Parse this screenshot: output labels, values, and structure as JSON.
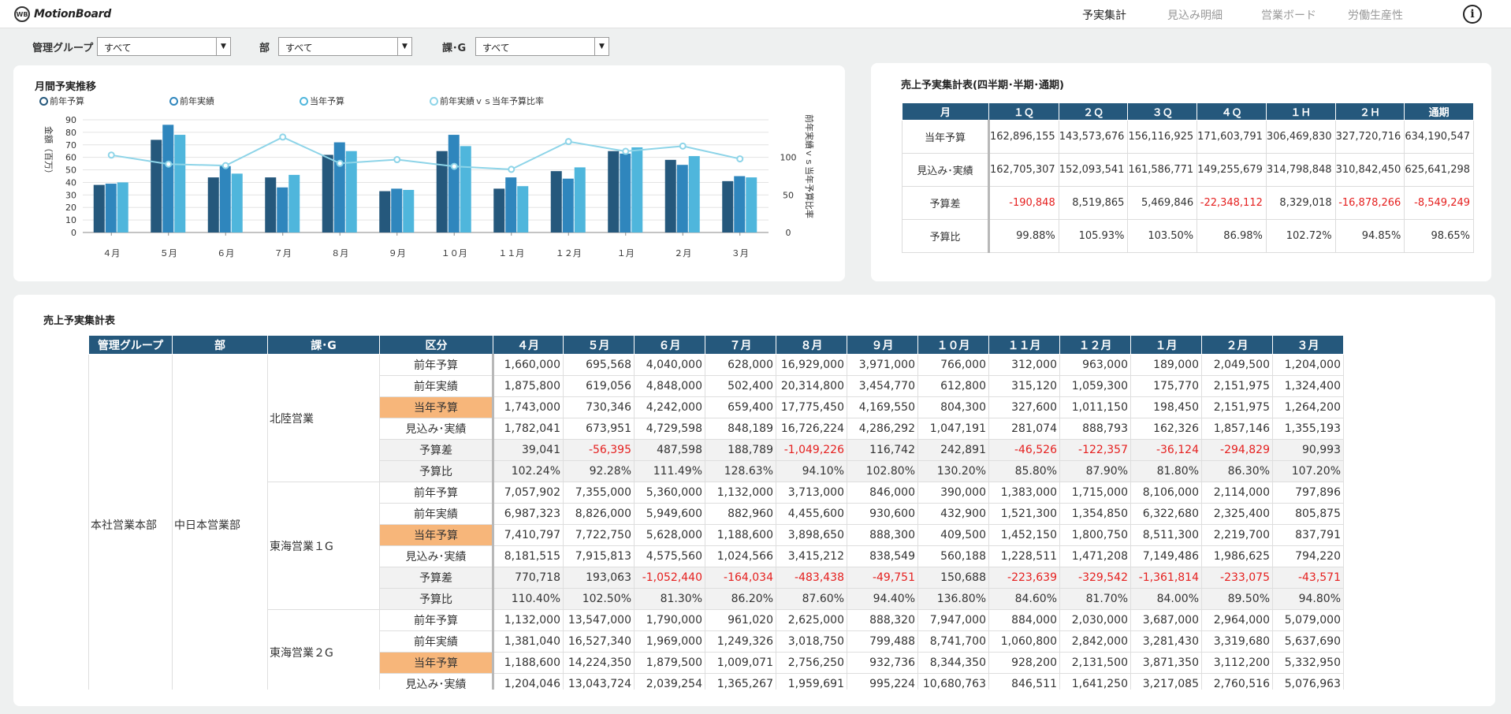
{
  "header": {
    "logo": "MotionBoard",
    "tabs": [
      {
        "label": "予実集計",
        "active": true
      },
      {
        "label": "見込み明細",
        "active": false
      },
      {
        "label": "営業ボード",
        "active": false
      },
      {
        "label": "労働生産性",
        "active": false
      }
    ],
    "info_icon": "info-icon"
  },
  "filters": [
    {
      "label": "管理グループ",
      "value": "すべて"
    },
    {
      "label": "部",
      "value": "すべて"
    },
    {
      "label": "課･G",
      "value": "すべて"
    }
  ],
  "monthly_chart": {
    "title": "月間予実推移",
    "legend": [
      {
        "label": "前年予算",
        "color": "#25587c"
      },
      {
        "label": "前年実績",
        "color": "#2f86bd"
      },
      {
        "label": "当年予算",
        "color": "#4fb6dc"
      },
      {
        "label": "前年実績ｖｓ当年予算比率",
        "color": "#8dd4e8"
      }
    ],
    "ylabel_left": "金額（百万）",
    "ylabel_right": "前年実績ｖｓ当年予算比率"
  },
  "chart_data": {
    "type": "bar",
    "categories": [
      "４月",
      "５月",
      "６月",
      "７月",
      "８月",
      "９月",
      "１０月",
      "１１月",
      "１２月",
      "１月",
      "２月",
      "３月"
    ],
    "series": [
      {
        "name": "前年予算",
        "values": [
          38,
          74,
          44,
          44,
          62,
          33,
          65,
          35,
          49,
          65,
          58,
          41
        ],
        "color": "#25587c"
      },
      {
        "name": "前年実績",
        "values": [
          39,
          86,
          53,
          36,
          72,
          35,
          78,
          44,
          43,
          63,
          54,
          45
        ],
        "color": "#2f86bd"
      },
      {
        "name": "当年予算",
        "values": [
          40,
          78,
          47,
          46,
          65,
          34,
          69,
          37,
          52,
          68,
          61,
          44
        ],
        "color": "#4fb6dc"
      }
    ],
    "line_series": {
      "name": "前年実績ｖｓ当年予算比率",
      "axis": "right",
      "values": [
        103,
        91,
        89,
        127,
        92,
        97,
        88,
        84,
        121,
        108,
        115,
        98
      ],
      "color": "#8dd4e8"
    },
    "y_ticks": [
      "0",
      "10",
      "20",
      "30",
      "40",
      "50",
      "60",
      "70",
      "80",
      "90"
    ],
    "y2_ticks": [
      "0",
      "50",
      "100"
    ],
    "ylim": [
      0,
      90
    ],
    "y2lim": [
      0,
      150
    ],
    "grid": true
  },
  "summary": {
    "title": "売上予実集計表(四半期･半期･通期)",
    "headers": [
      "月",
      "１Ｑ",
      "２Ｑ",
      "３Ｑ",
      "４Ｑ",
      "１Ｈ",
      "２Ｈ",
      "通期"
    ],
    "rows": [
      {
        "label": "当年予算",
        "values": [
          "162,896,155",
          "143,573,676",
          "156,116,925",
          "171,603,791",
          "306,469,830",
          "327,720,716",
          "634,190,547"
        ]
      },
      {
        "label": "見込み･実績",
        "values": [
          "162,705,307",
          "152,093,541",
          "161,586,771",
          "149,255,679",
          "314,798,848",
          "310,842,450",
          "625,641,298"
        ]
      },
      {
        "label": "予算差",
        "values": [
          "-190,848",
          "8,519,865",
          "5,469,846",
          "-22,348,112",
          "8,329,018",
          "-16,878,266",
          "-8,549,249"
        ]
      },
      {
        "label": "予算比",
        "values": [
          "99.88%",
          "105.93%",
          "103.50%",
          "86.98%",
          "102.72%",
          "94.85%",
          "98.65%"
        ]
      }
    ]
  },
  "detail": {
    "title": "売上予実集計表",
    "headers": [
      "管理グループ",
      "部",
      "課･G",
      "区分",
      "４月",
      "５月",
      "６月",
      "７月",
      "８月",
      "９月",
      "１０月",
      "１１月",
      "１２月",
      "１月",
      "２月",
      "３月"
    ],
    "group": "本社営業本部",
    "dept": "中日本営業部",
    "sections": [
      {
        "name": "北陸営業",
        "rows": [
          {
            "kubun": "前年予算",
            "values": [
              "1,660,000",
              "695,568",
              "4,040,000",
              "628,000",
              "16,929,000",
              "3,971,000",
              "766,000",
              "312,000",
              "963,000",
              "189,000",
              "2,049,500",
              "1,204,000"
            ]
          },
          {
            "kubun": "前年実績",
            "values": [
              "1,875,800",
              "619,056",
              "4,848,000",
              "502,400",
              "20,314,800",
              "3,454,770",
              "612,800",
              "315,120",
              "1,059,300",
              "175,770",
              "2,151,975",
              "1,324,400"
            ]
          },
          {
            "kubun": "当年予算",
            "values": [
              "1,743,000",
              "730,346",
              "4,242,000",
              "659,400",
              "17,775,450",
              "4,169,550",
              "804,300",
              "327,600",
              "1,011,150",
              "198,450",
              "2,151,975",
              "1,264,200"
            ]
          },
          {
            "kubun": "見込み･実績",
            "values": [
              "1,782,041",
              "673,951",
              "4,729,598",
              "848,189",
              "16,726,224",
              "4,286,292",
              "1,047,191",
              "281,074",
              "888,793",
              "162,326",
              "1,857,146",
              "1,355,193"
            ]
          },
          {
            "kubun": "予算差",
            "values": [
              "39,041",
              "-56,395",
              "487,598",
              "188,789",
              "-1,049,226",
              "116,742",
              "242,891",
              "-46,526",
              "-122,357",
              "-36,124",
              "-294,829",
              "90,993"
            ]
          },
          {
            "kubun": "予算比",
            "values": [
              "102.24%",
              "92.28%",
              "111.49%",
              "128.63%",
              "94.10%",
              "102.80%",
              "130.20%",
              "85.80%",
              "87.90%",
              "81.80%",
              "86.30%",
              "107.20%"
            ]
          }
        ]
      },
      {
        "name": "東海営業１G",
        "rows": [
          {
            "kubun": "前年予算",
            "values": [
              "7,057,902",
              "7,355,000",
              "5,360,000",
              "1,132,000",
              "3,713,000",
              "846,000",
              "390,000",
              "1,383,000",
              "1,715,000",
              "8,106,000",
              "2,114,000",
              "797,896"
            ]
          },
          {
            "kubun": "前年実績",
            "values": [
              "6,987,323",
              "8,826,000",
              "5,949,600",
              "882,960",
              "4,455,600",
              "930,600",
              "432,900",
              "1,521,300",
              "1,354,850",
              "6,322,680",
              "2,325,400",
              "805,875"
            ]
          },
          {
            "kubun": "当年予算",
            "values": [
              "7,410,797",
              "7,722,750",
              "5,628,000",
              "1,188,600",
              "3,898,650",
              "888,300",
              "409,500",
              "1,452,150",
              "1,800,750",
              "8,511,300",
              "2,219,700",
              "837,791"
            ]
          },
          {
            "kubun": "見込み･実績",
            "values": [
              "8,181,515",
              "7,915,813",
              "4,575,560",
              "1,024,566",
              "3,415,212",
              "838,549",
              "560,188",
              "1,228,511",
              "1,471,208",
              "7,149,486",
              "1,986,625",
              "794,220"
            ]
          },
          {
            "kubun": "予算差",
            "values": [
              "770,718",
              "193,063",
              "-1,052,440",
              "-164,034",
              "-483,438",
              "-49,751",
              "150,688",
              "-223,639",
              "-329,542",
              "-1,361,814",
              "-233,075",
              "-43,571"
            ]
          },
          {
            "kubun": "予算比",
            "values": [
              "110.40%",
              "102.50%",
              "81.30%",
              "86.20%",
              "87.60%",
              "94.40%",
              "136.80%",
              "84.60%",
              "81.70%",
              "84.00%",
              "89.50%",
              "94.80%"
            ]
          }
        ]
      },
      {
        "name": "東海営業２G",
        "rows": [
          {
            "kubun": "前年予算",
            "values": [
              "1,132,000",
              "13,547,000",
              "1,790,000",
              "961,020",
              "2,625,000",
              "888,320",
              "7,947,000",
              "884,000",
              "2,030,000",
              "3,687,000",
              "2,964,000",
              "5,079,000"
            ]
          },
          {
            "kubun": "前年実績",
            "values": [
              "1,381,040",
              "16,527,340",
              "1,969,000",
              "1,249,326",
              "3,018,750",
              "799,488",
              "8,741,700",
              "1,060,800",
              "2,842,000",
              "3,281,430",
              "3,319,680",
              "5,637,690"
            ]
          },
          {
            "kubun": "当年予算",
            "values": [
              "1,188,600",
              "14,224,350",
              "1,879,500",
              "1,009,071",
              "2,756,250",
              "932,736",
              "8,344,350",
              "928,200",
              "2,131,500",
              "3,871,350",
              "3,112,200",
              "5,332,950"
            ]
          },
          {
            "kubun": "見込み･実績",
            "values": [
              "1,204,046",
              "13,043,724",
              "2,039,254",
              "1,365,267",
              "1,959,691",
              "995,224",
              "10,680,763",
              "846,511",
              "1,641,250",
              "3,217,085",
              "2,760,516",
              "5,076,963"
            ]
          }
        ]
      }
    ]
  }
}
